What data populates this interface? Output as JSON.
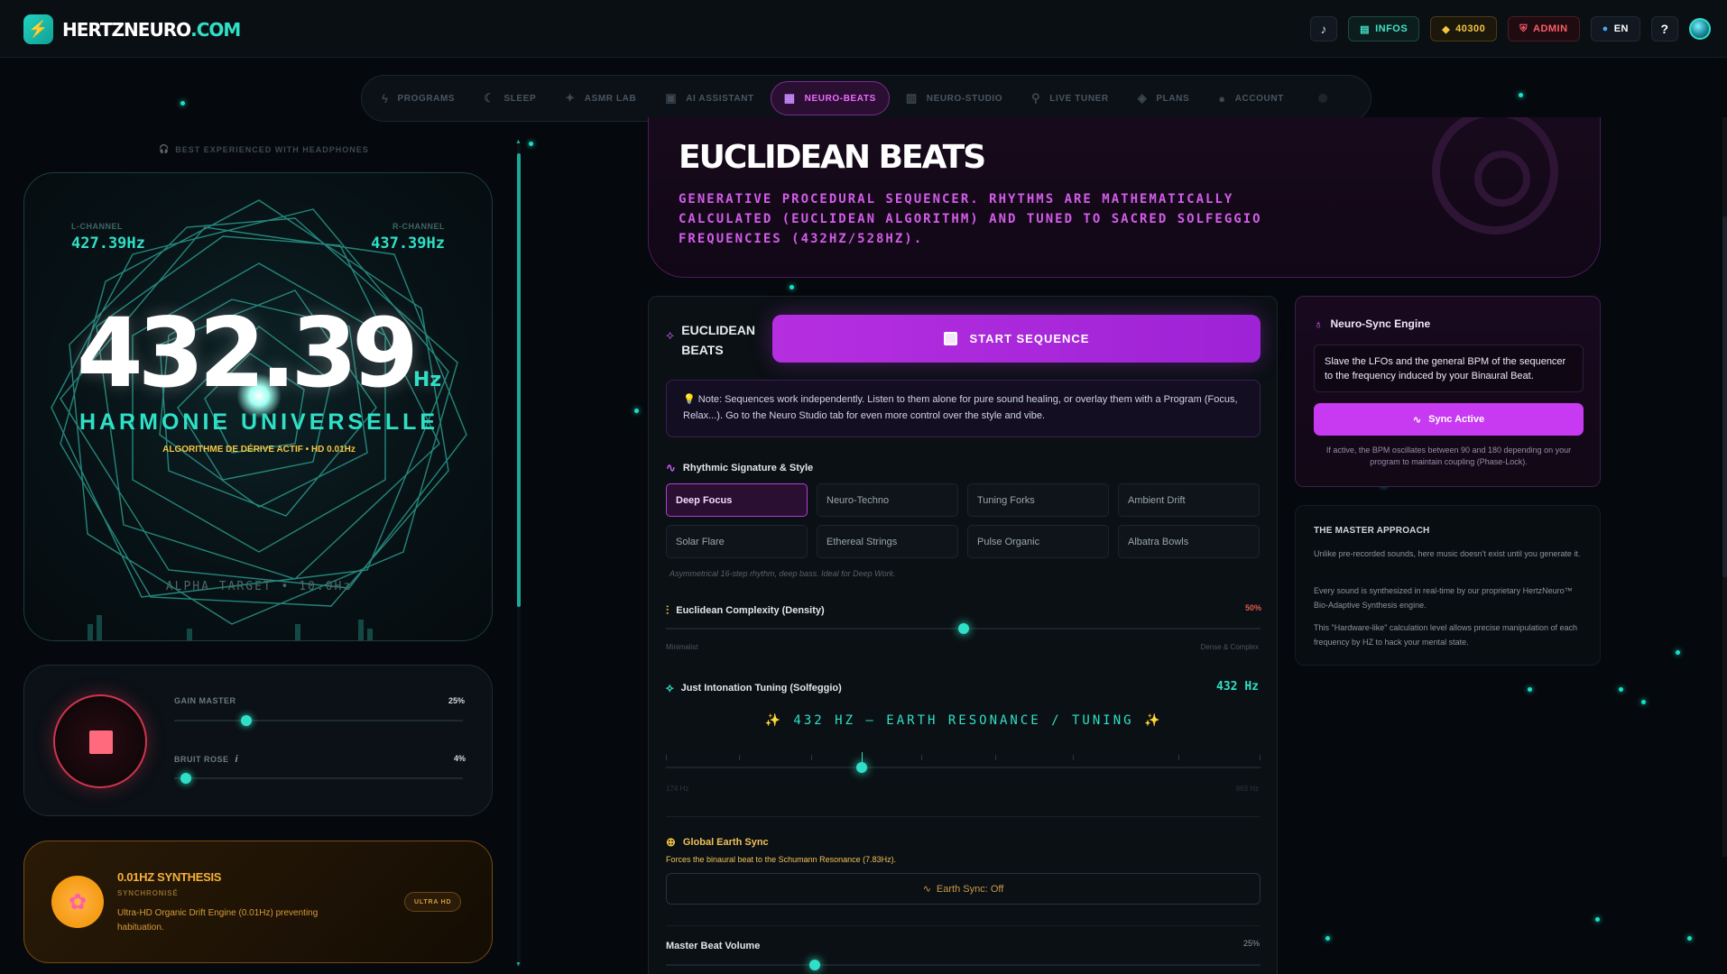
{
  "app": {
    "logo_main": "HERTZNEURO",
    "logo_suffix": ".COM"
  },
  "topbar": {
    "infos": "INFOS",
    "coins": "40300",
    "admin": "ADMIN",
    "lang": "EN",
    "help": "?"
  },
  "nav": [
    {
      "label": "PROGRAMS",
      "icon": "bolt-icon"
    },
    {
      "label": "SLEEP",
      "icon": "moon-icon"
    },
    {
      "label": "ASMR LAB",
      "icon": "sparkle-icon"
    },
    {
      "label": "AI ASSISTANT",
      "icon": "robot-icon"
    },
    {
      "label": "NEURO-BEATS",
      "icon": "grid-icon",
      "active": true
    },
    {
      "label": "NEURO-STUDIO",
      "icon": "piano-icon"
    },
    {
      "label": "LIVE TUNER",
      "icon": "mic-icon"
    },
    {
      "label": "PLANS",
      "icon": "tag-icon"
    },
    {
      "label": "ACCOUNT",
      "icon": "user-icon"
    }
  ],
  "left": {
    "headphones": "BEST EXPERIENCED WITH HEADPHONES",
    "l_label": "L-CHANNEL",
    "l_value": "427.39Hz",
    "r_label": "R-CHANNEL",
    "r_value": "437.39Hz",
    "freq": "432.39",
    "freq_unit": "Hz",
    "name": "HARMONIE UNIVERSELLE",
    "algo": "ALGORITHME DE DÉRIVE ACTIF • HD 0.01Hz",
    "alpha": "ALPHA TARGET • 10.0Hz",
    "gain_label": "GAIN MASTER",
    "gain_pct": "25%",
    "gain_value": 0.25,
    "noise_label": "BRUIT ROSE",
    "noise_pct": "4%",
    "noise_value": 0.04,
    "synth_title": "0.01HZ SYNTHESIS",
    "synth_sub": "SYNCHRONISÉ",
    "synth_desc": "Ultra-HD Organic Drift Engine (0.01Hz) preventing habituation.",
    "synth_badge": "ULTRA HD"
  },
  "hero": {
    "title": "EUCLIDEAN BEATS",
    "desc": "GENERATIVE PROCEDURAL SEQUENCER. RHYTHMS ARE MATHEMATICALLY CALCULATED (EUCLIDEAN ALGORITHM) AND TUNED TO SACRED SOLFEGGIO FREQUENCIES (432HZ/528HZ)."
  },
  "seq": {
    "logo": "EUCLIDEAN BEATS",
    "start": "START SEQUENCE",
    "note": "💡 Note: Sequences work independently. Listen to them alone for pure sound healing, or overlay them with a Program (Focus, Relax...). Go to the Neuro Studio tab for even more control over the style and vibe.",
    "style_heading": "Rhythmic Signature & Style",
    "styles": [
      "Deep Focus",
      "Neuro-Techno",
      "Tuning Forks",
      "Ambient Drift",
      "Solar Flare",
      "Ethereal Strings",
      "Pulse Organic",
      "Albatra Bowls"
    ],
    "style_note": "Asymmetrical 16-step rhythm, deep bass. Ideal for Deep Work.",
    "complexity_heading": "Euclidean Complexity (Density)",
    "complexity_pct": "50%",
    "complexity_value": 0.5,
    "complexity_min": "Minimalist",
    "complexity_max": "Dense & Complex",
    "tuning_heading": "Just Intonation Tuning (Solfeggio)",
    "tuning_value": "432 Hz",
    "tuning_banner": "✨ 432 HZ — EARTH RESONANCE / TUNING ✨",
    "tuning_min": "174 Hz",
    "tuning_max": "963 Hz",
    "tuning_position": 0.33,
    "sync_heading": "Global Earth Sync",
    "sync_desc": "Forces the binaural beat to the Schumann Resonance (7.83Hz).",
    "sync_btn": "Earth Sync: Off",
    "volume_label": "Master Beat Volume",
    "volume_pct": "25%",
    "volume_value": 0.25
  },
  "neurosync": {
    "title": "Neuro-Sync Engine",
    "box": "Slave the LFOs and the general BPM of the sequencer to the frequency induced by your Binaural Beat.",
    "button": "Sync Active",
    "note": "If active, the BPM oscillates between 90 and 180 depending on your program to maintain coupling (Phase-Lock)."
  },
  "master": {
    "title": "THE MASTER APPROACH",
    "p1": "Unlike pre-recorded sounds, here music doesn't exist until you generate it.",
    "p2": "Every sound is synthesized in real-time by our proprietary HertzNeuro™ Bio-Adaptive Synthesis engine.",
    "p3": "This \"Hardware-like\" calculation level allows precise manipulation of each frequency by HZ to hack your mental state."
  }
}
